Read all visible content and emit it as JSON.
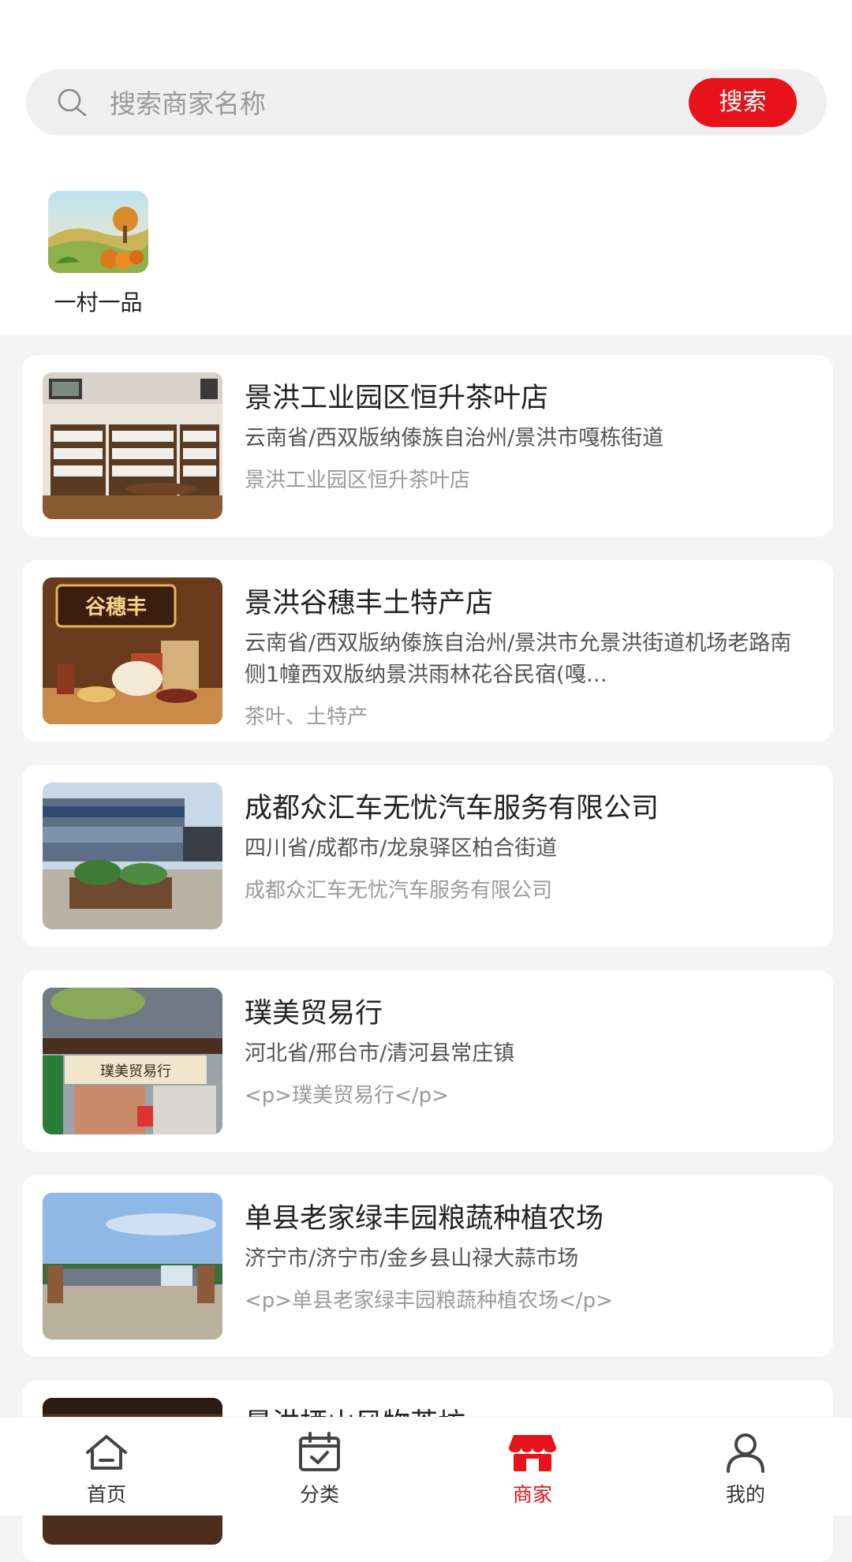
{
  "search": {
    "placeholder": "搜索商家名称",
    "button_label": "搜索"
  },
  "categories": [
    {
      "label": "一村一品",
      "icon": "farm-landscape-icon"
    }
  ],
  "merchants": [
    {
      "name": "景洪工业园区恒升茶叶店",
      "address": "云南省/西双版纳傣族自治州/景洪市嘎栋街道",
      "description": "景洪工业园区恒升茶叶店"
    },
    {
      "name": "景洪谷穗丰土特产店",
      "address": "云南省/西双版纳傣族自治州/景洪市允景洪街道机场老路南侧1幢西双版纳景洪雨林花谷民宿(嘎…",
      "description": "茶叶、土特产",
      "sign_text": "谷穗丰"
    },
    {
      "name": "成都众汇车无忧汽车服务有限公司",
      "address": "四川省/成都市/龙泉驿区柏合街道",
      "description": "成都众汇车无忧汽车服务有限公司"
    },
    {
      "name": "璞美贸易行",
      "address": "河北省/邢台市/清河县常庄镇",
      "description": "<p>璞美贸易行</p>",
      "sign_text": "璞美贸易行"
    },
    {
      "name": "单县老家绿丰园粮蔬种植农场",
      "address": "济宁市/济宁市/金乡县山禄大蒜市场",
      "description": "<p>单县老家绿丰园粮蔬种植农场</p>"
    },
    {
      "name": "景洪栖山风物茶坊",
      "address": "",
      "description": ""
    }
  ],
  "tabbar": [
    {
      "label": "首页",
      "icon": "home-icon",
      "active": false
    },
    {
      "label": "分类",
      "icon": "calendar-check-icon",
      "active": false
    },
    {
      "label": "商家",
      "icon": "shop-icon",
      "active": true
    },
    {
      "label": "我的",
      "icon": "user-icon",
      "active": false
    }
  ],
  "colors": {
    "accent": "#e8131a",
    "background": "#f4f4f4",
    "card": "#ffffff"
  }
}
